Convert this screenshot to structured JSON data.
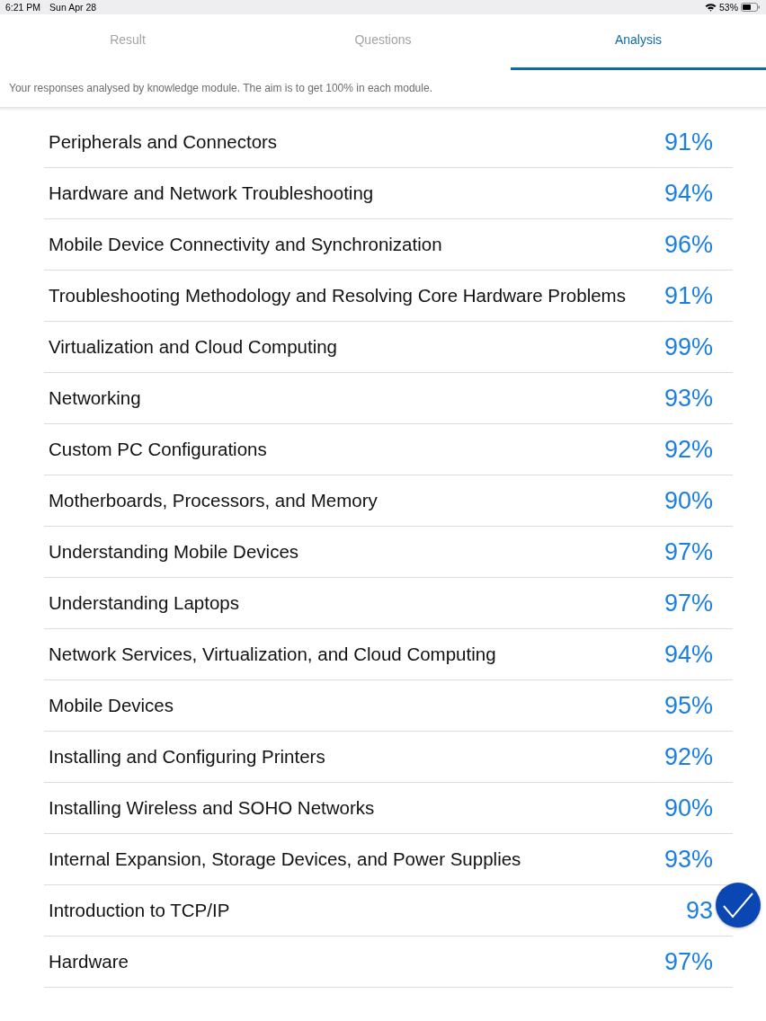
{
  "status_bar": {
    "time": "6:21 PM",
    "date": "Sun Apr 28",
    "battery": "53%"
  },
  "tabs": [
    {
      "label": "Result",
      "selected": false
    },
    {
      "label": "Questions",
      "selected": false
    },
    {
      "label": "Analysis",
      "selected": true
    }
  ],
  "description": "Your responses analysed by knowledge module. The aim is to get 100% in each module.",
  "modules": [
    {
      "name": "Peripherals and Connectors",
      "score": "91%"
    },
    {
      "name": "Hardware and Network Troubleshooting",
      "score": "94%"
    },
    {
      "name": "Mobile Device Connectivity and Synchronization",
      "score": "96%"
    },
    {
      "name": "Troubleshooting Methodology and Resolving Core Hardware Problems",
      "score": "91%"
    },
    {
      "name": "Virtualization and Cloud Computing",
      "score": "99%"
    },
    {
      "name": "Networking",
      "score": "93%"
    },
    {
      "name": "Custom PC Configurations",
      "score": "92%"
    },
    {
      "name": "Motherboards, Processors, and Memory",
      "score": "90%"
    },
    {
      "name": "Understanding Mobile Devices",
      "score": "97%"
    },
    {
      "name": "Understanding Laptops",
      "score": "97%"
    },
    {
      "name": "Network Services, Virtualization, and Cloud Computing",
      "score": "94%"
    },
    {
      "name": "Mobile Devices",
      "score": "95%"
    },
    {
      "name": "Installing and Configuring Printers",
      "score": "92%"
    },
    {
      "name": "Installing Wireless and SOHO Networks",
      "score": "90%"
    },
    {
      "name": "Internal Expansion, Storage Devices, and Power Supplies",
      "score": "93%"
    },
    {
      "name": "Introduction to TCP/IP",
      "score": "93"
    },
    {
      "name": "Hardware",
      "score": "97%"
    }
  ]
}
